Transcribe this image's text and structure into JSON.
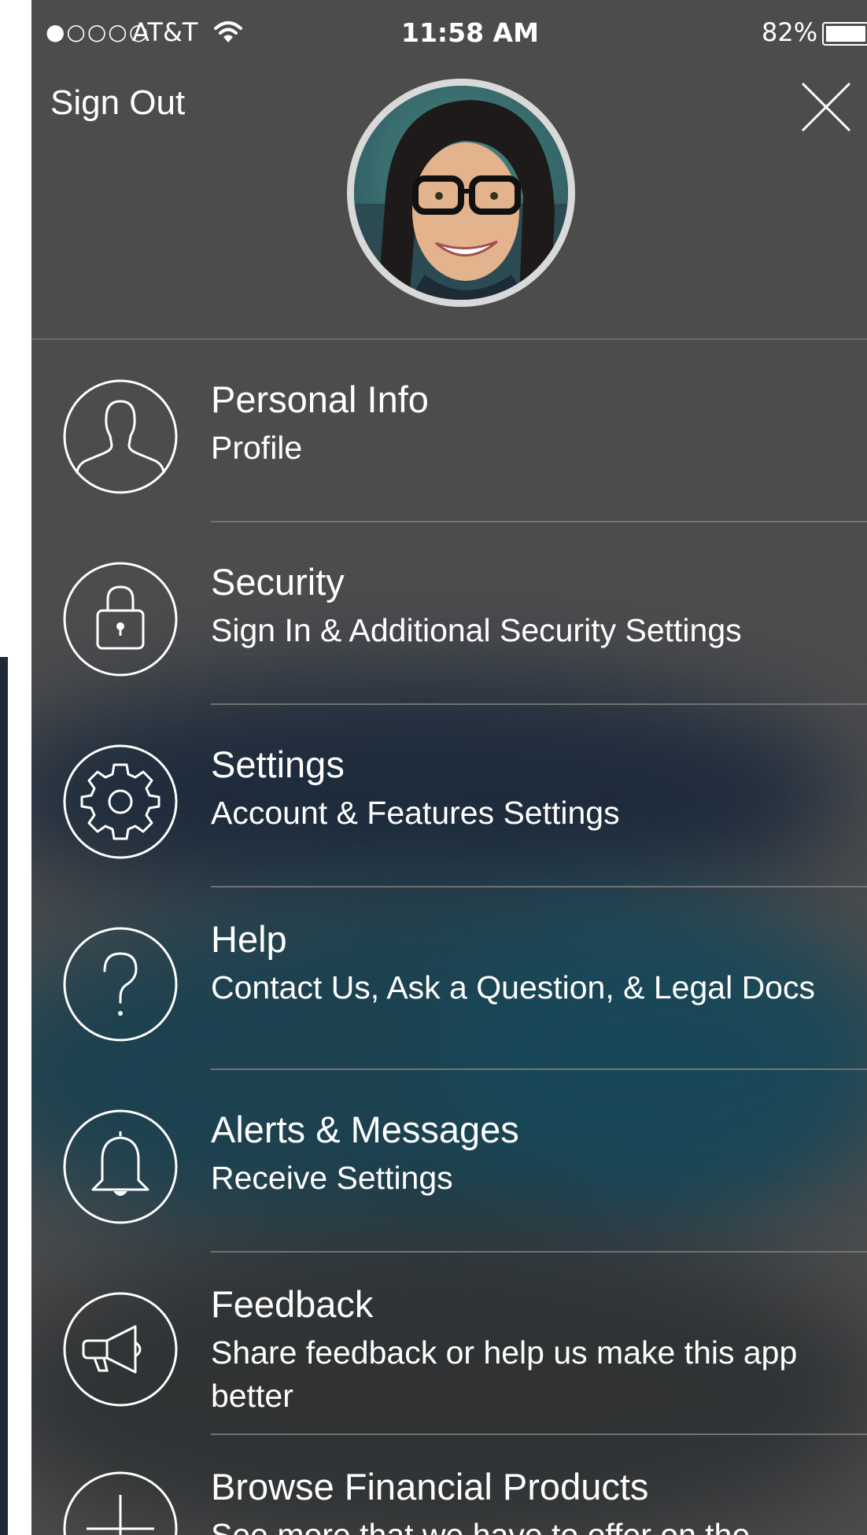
{
  "status_bar": {
    "signal": "●○○○○",
    "carrier": "AT&T",
    "time": "11:58 AM",
    "battery": "82%"
  },
  "header": {
    "sign_out": "Sign Out"
  },
  "icons": {
    "wifi": "wifi-icon",
    "close": "close-icon",
    "avatar": "avatar-photo"
  },
  "menu": [
    {
      "title": "Personal Info",
      "subtitle": "Profile",
      "icon": "person-icon"
    },
    {
      "title": "Security",
      "subtitle": "Sign In & Additional Security Settings",
      "icon": "lock-icon"
    },
    {
      "title": "Settings",
      "subtitle": "Account & Features Settings",
      "icon": "gear-icon"
    },
    {
      "title": "Help",
      "subtitle": "Contact Us, Ask a Question, & Legal Docs",
      "icon": "question-icon"
    },
    {
      "title": "Alerts & Messages",
      "subtitle": "Receive Settings",
      "icon": "bell-icon"
    },
    {
      "title": "Feedback",
      "subtitle": "Share feedback or help us make this app better",
      "icon": "megaphone-icon"
    },
    {
      "title": "Browse Financial Products",
      "subtitle": "See more that we have to offer on the",
      "icon": "plus-icon"
    }
  ]
}
